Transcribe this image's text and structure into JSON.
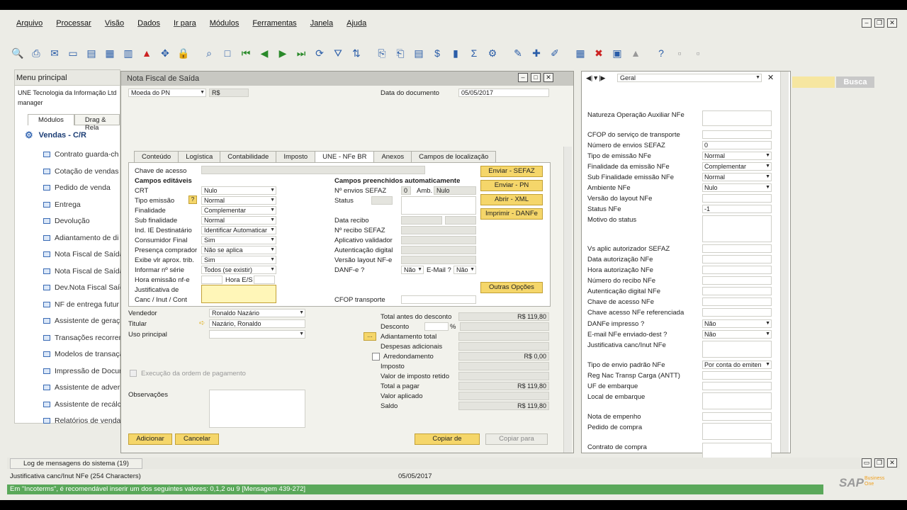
{
  "menu": [
    "Arquivo",
    "Processar",
    "Visão",
    "Dados",
    "Ir para",
    "Módulos",
    "Ferramentas",
    "Janela",
    "Ajuda"
  ],
  "left": {
    "title": "Menu principal",
    "company": "UNE Tecnologia da Informação Ltd",
    "user": "manager",
    "tabs": [
      "Módulos",
      "Drag & Rela"
    ],
    "section": "Vendas - C/R",
    "items": [
      "Contrato guarda-ch",
      "Cotação de vendas",
      "Pedido de venda",
      "Entrega",
      "Devolução",
      "Adiantamento de di",
      "Nota Fiscal de Saída",
      "Nota Fiscal de Saída",
      "Dev.Nota Fiscal Saíd",
      "NF de entrega futur",
      "Assistente de geraç",
      "Transações recorren",
      "Modelos de transaçã",
      "Impressão de Docur",
      "Assistente de adver",
      "Assistente de recálc",
      "Relatórios de venda"
    ]
  },
  "main": {
    "title": "Nota Fiscal de Saída",
    "moeda_label": "Moeda do PN",
    "moeda_value": "R$",
    "data_doc_label": "Data do documento",
    "data_doc_value": "05/05/2017",
    "tabs": [
      "Conteúdo",
      "Logística",
      "Contabilidade",
      "Imposto",
      "UNE - NFe BR",
      "Anexos",
      "Campos de localização"
    ],
    "chave_label": "Chave de acesso",
    "editaveis": "Campos editáveis",
    "automaticos": "Campos preenchidos automaticamente",
    "fields": [
      {
        "l": "CRT",
        "v": "Nulo"
      },
      {
        "l": "Tipo emissão",
        "v": "Normal"
      },
      {
        "l": "Finalidade",
        "v": "Complementar"
      },
      {
        "l": "Sub finalidade",
        "v": "Normal"
      },
      {
        "l": "Ind. IE Destinatário",
        "v": "Identificar Automaticar"
      },
      {
        "l": "Consumidor Final",
        "v": "Sim"
      },
      {
        "l": "Presença comprador",
        "v": "Não se aplica"
      },
      {
        "l": "Exibe vlr aprox. trib.",
        "v": "Sim"
      },
      {
        "l": "Informar nº série",
        "v": "Todos (se existir)"
      }
    ],
    "hora_emissao": "Hora emissão nf-e",
    "hora_es": "Hora E/S",
    "justificativa": "Justificativa de",
    "canc": "Canc / Inut / Cont",
    "nenvios_label": "Nº envios SEFAZ",
    "nenvios_value": "0",
    "amb_label": "Amb.",
    "amb_value": "Nulo",
    "status_label": "Status",
    "data_recibo": "Data recibo",
    "nrecibo": "Nº recibo SEFAZ",
    "aplicativo": "Aplicativo validador",
    "autenticacao": "Autenticação digital",
    "versao": "Versão layout NF-e",
    "danfe_label": "DANF-e ?",
    "danfe_value": "Não",
    "email_label": "E-Mail ?",
    "email_value": "Não",
    "cfop": "CFOP transporte",
    "btn_enviar_sefaz": "Enviar - SEFAZ",
    "btn_enviar_pn": "Enviar - PN",
    "btn_abrir_xml": "Abrir - XML",
    "btn_imprimir": "Imprimir - DANFe",
    "btn_outras": "Outras Opções",
    "vendedor_label": "Vendedor",
    "vendedor_value": "Ronaldo Nazário",
    "titular_label": "Titular",
    "titular_value": "Nazário, Ronaldo",
    "uso_label": "Uso principal",
    "execucao": "Execução da ordem de pagamento",
    "observacoes": "Observações",
    "totals": [
      {
        "l": "Total antes do desconto",
        "v": "R$ 119,80"
      },
      {
        "l": "Desconto",
        "v": ""
      },
      {
        "l": "Adiantamento total",
        "v": ""
      },
      {
        "l": "Despesas adicionais",
        "v": ""
      },
      {
        "l": "Arredondamento",
        "v": "R$ 0,00"
      },
      {
        "l": "Imposto",
        "v": ""
      },
      {
        "l": "Valor de imposto retido",
        "v": ""
      },
      {
        "l": "Total a pagar",
        "v": "R$ 119,80"
      },
      {
        "l": "Valor aplicado",
        "v": ""
      },
      {
        "l": "Saldo",
        "v": "R$ 119,80"
      }
    ],
    "pct": "%",
    "btn_adicionar": "Adicionar",
    "btn_cancelar": "Cancelar",
    "btn_copiar_de": "Copiar de",
    "btn_copiar_para": "Copiar para"
  },
  "right": {
    "dropdown": "Geral",
    "rows": [
      {
        "l": "Natureza Operação Auxiliar NFe",
        "v": "",
        "t": 142,
        "h": 22
      },
      {
        "l": "CFOP do serviço de transporte",
        "v": "",
        "t": 170
      },
      {
        "l": "Número de envios SEFAZ",
        "v": "0",
        "t": 185
      },
      {
        "l": "Tipo de emissão NFe",
        "v": "Normal",
        "t": 200,
        "s": true
      },
      {
        "l": "Finalidade da emissão NFe",
        "v": "Complementar",
        "t": 215,
        "s": true
      },
      {
        "l": "Sub Finalidade emissão NFe",
        "v": "Normal",
        "t": 230,
        "s": true
      },
      {
        "l": "Ambiente NFe",
        "v": "Nulo",
        "t": 245,
        "s": true
      },
      {
        "l": "Versão do layout NFe",
        "v": "",
        "t": 260
      },
      {
        "l": "Status NFe",
        "v": "-1",
        "t": 275
      },
      {
        "l": "Motivo do status",
        "v": "",
        "t": 290,
        "h": 38
      },
      {
        "l": "Vs aplic autorizador SEFAZ",
        "v": "",
        "t": 331
      },
      {
        "l": "Data autorização NFe",
        "v": "",
        "t": 346
      },
      {
        "l": "Hora autorização NFe",
        "v": "",
        "t": 361
      },
      {
        "l": "Número do recibo NFe",
        "v": "",
        "t": 376
      },
      {
        "l": "Autenticação digital NFe",
        "v": "",
        "t": 391
      },
      {
        "l": "Chave de acesso NFe",
        "v": "",
        "t": 406
      },
      {
        "l": "Chave acesso NFe referenciada",
        "v": "",
        "t": 421
      },
      {
        "l": "DANFe impresso ?",
        "v": "Não",
        "t": 437,
        "s": true
      },
      {
        "l": "E-mail NFe enviado-dest ?",
        "v": "Não",
        "t": 452,
        "s": true
      },
      {
        "l": "Justificativa canc/Inut NFe",
        "v": "",
        "t": 467,
        "h": 24
      },
      {
        "l": "Tipo de envio padrão NFe",
        "v": "Por conta do emiten",
        "t": 495,
        "s": true
      },
      {
        "l": "Reg Nac Transp Carga (ANTT)",
        "v": "",
        "t": 510
      },
      {
        "l": "UF de embarque",
        "v": "",
        "t": 525
      },
      {
        "l": "Local de embarque",
        "v": "",
        "t": 540,
        "h": 24
      },
      {
        "l": "Nota de empenho",
        "v": "",
        "t": 568
      },
      {
        "l": "Pedido de compra",
        "v": "",
        "t": 583,
        "h": 24
      },
      {
        "l": "Contrato de compra",
        "v": "",
        "t": 611,
        "h": 24
      }
    ]
  },
  "search_btn": "Busca",
  "log": "Log de mensagens do sistema (19)",
  "status_field": "Justificativa canc/Inut NFe (254 Characters)",
  "status_date": "05/05/2017",
  "status_message": "Em \"Incoterms\", é recomendável inserir um dos seguintes valores: 0,1,2 ou 9  [Mensagem 439-272]",
  "brand": "SAP",
  "brand_sub": "Business One"
}
